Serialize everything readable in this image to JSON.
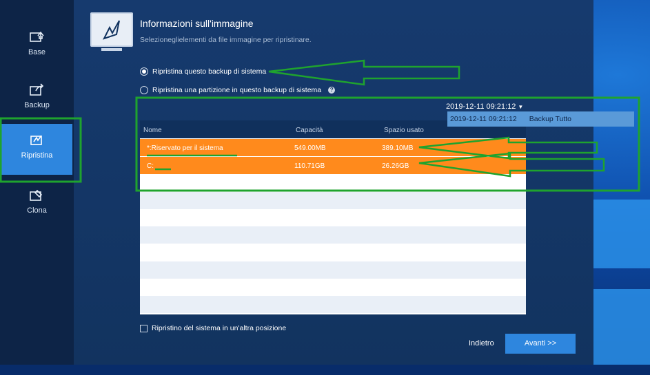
{
  "sidebar": {
    "items": [
      {
        "label": "Base",
        "icon": "base-icon"
      },
      {
        "label": "Backup",
        "icon": "backup-icon"
      },
      {
        "label": "Ripristina",
        "icon": "restore-icon"
      },
      {
        "label": "Clona",
        "icon": "clone-icon"
      }
    ]
  },
  "header": {
    "title": "Informazioni sull'immagine",
    "subtitle": "Selezioneglielementi da file immagine per ripristinare."
  },
  "options": {
    "restore_system": "Ripristina questo backup di sistema",
    "restore_partition": "Ripristina una partizione in questo backup di sistema"
  },
  "date_select": {
    "value": "2019-12-11 09:21:12",
    "dropdown_date": "2019-12-11 09:21:12",
    "dropdown_type": "Backup Tutto"
  },
  "table": {
    "headers": {
      "name": "Nome",
      "capacity": "Capacità",
      "used": "Spazio usato"
    },
    "rows": [
      {
        "name": "*:Riservato per il sistema",
        "capacity": "549.00MB",
        "used": "389.10MB"
      },
      {
        "name": "C:",
        "capacity": "110.71GB",
        "used": "26.26GB"
      }
    ]
  },
  "footer": {
    "other_location": "Ripristino del sistema in un'altra posizione",
    "back": "Indietro",
    "next": "Avanti >>"
  },
  "colors": {
    "accent": "#2e86de",
    "selection": "#ff8a1c",
    "annotation": "#1fa32e"
  }
}
